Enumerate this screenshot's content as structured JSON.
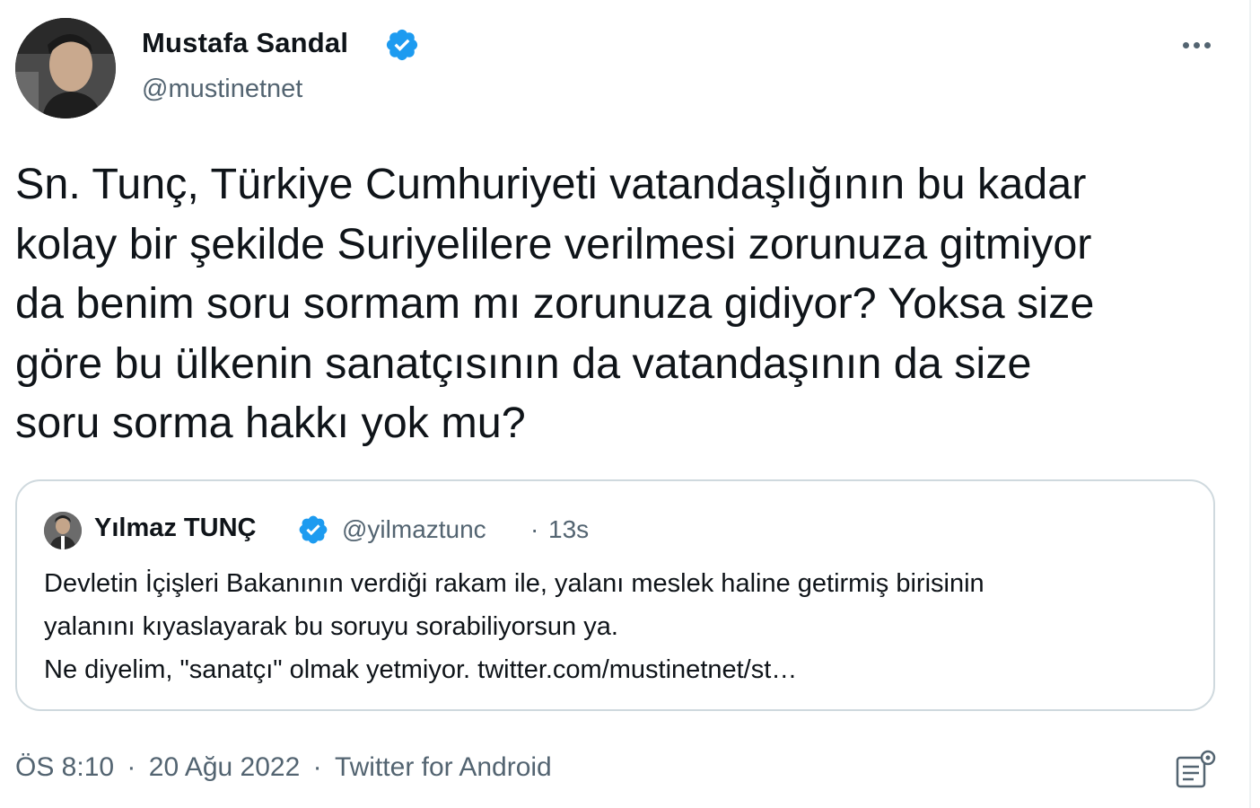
{
  "author": {
    "name": "Mustafa Sandal",
    "handle": "@mustinetnet"
  },
  "tweet": {
    "text": "Sn. Tunç, Türkiye Cumhuriyeti vatandaşlığının bu kadar\nkolay bir şekilde Suriyelilere verilmesi zorunuza gitmiyor\nda benim soru sormam mı zorunuza gidiyor? Yoksa size\ngöre bu ülkenin sanatçısının da vatandaşının da size\nsoru sorma hakkı yok mu?"
  },
  "quote": {
    "name": "Yılmaz TUNÇ",
    "handle": "@yilmaztunc",
    "separator": "·",
    "time": "13s",
    "lines": [
      "Devletin İçişleri Bakanının verdiği rakam ile, yalanı meslek haline getirmiş birisinin",
      "yalanını kıyaslayarak bu soruyu sorabiliyorsun ya.",
      "Ne diyelim, \"sanatçı\" olmak yetmiyor. twitter.com/mustinetnet/st…"
    ]
  },
  "meta": {
    "time": "ÖS 8:10",
    "separator": "·",
    "date": "20 Ağu 2022",
    "source": "Twitter for Android"
  },
  "icons": {
    "verified": "verified-badge-icon",
    "more": "more-icon",
    "analytics": "analytics-icon"
  },
  "colors": {
    "verified": "#1d9bf0",
    "secondary_text": "#536471",
    "primary_text": "#0f1419",
    "card_border": "#cfd9de"
  }
}
